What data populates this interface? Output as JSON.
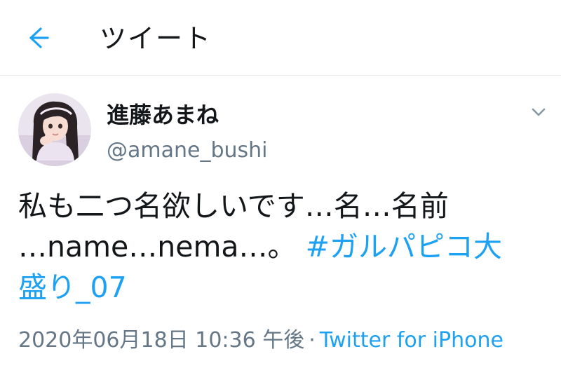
{
  "header": {
    "title": "ツイート",
    "back_icon": "arrow-left-icon",
    "accent": "#1da1f2"
  },
  "tweet": {
    "display_name": "進藤あまね",
    "handle": "@amane_bushi",
    "text_line1": "私も二つ名欲しいです…名…名前",
    "text_line2_plain": "…name…nema…。 ",
    "hashtag_part1": "#ガルパピコ大",
    "hashtag_part2": "盛り_07",
    "timestamp": "2020年06月18日 10:36 午後",
    "separator": "·",
    "source": "Twitter for iPhone",
    "more_icon": "chevron-down-icon",
    "avatar_icon": "avatar-photo"
  },
  "colors": {
    "text": "#14171a",
    "secondary": "#657786",
    "link": "#1da1f2",
    "divider": "#e6ecf0"
  }
}
